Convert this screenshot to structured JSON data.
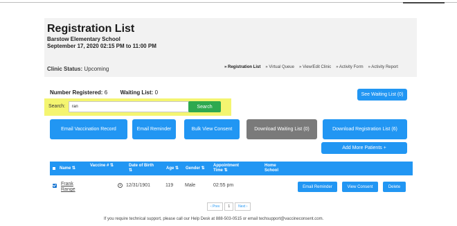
{
  "header": {
    "title": "Registration List",
    "school": "Barstow Elementary School",
    "dates": "September 17, 2020 02:15 PM to 11:00 PM",
    "clinic_status_label": "Clinic Status:",
    "clinic_status_value": "Upcoming"
  },
  "nav": {
    "items": [
      "Registration List",
      "Virtual Queue",
      "View/Edit Clinic",
      "Activity Form",
      "Activity Report"
    ]
  },
  "counts": {
    "registered_label": "Number Registered:",
    "registered_value": "6",
    "waiting_label": "Waiting List:",
    "waiting_value": "0"
  },
  "buttons": {
    "see_waiting": "See Waiting List (0)",
    "email_vaccination": "Email Vaccination Record",
    "email_reminder": "Email Reminder",
    "bulk_view_consent": "Bulk View Consent",
    "download_waiting": "Download Waiting List (0)",
    "download_registration": "Download Registration List (6)",
    "add_patients": "Add More Patients +"
  },
  "search": {
    "label": "Search:",
    "value": "ran",
    "button": "Search"
  },
  "table": {
    "columns": [
      "Name",
      "Vaccine #",
      "Date of Birth",
      "Age",
      "Gender",
      "Appointment Time",
      "Home School"
    ],
    "rows": [
      {
        "name": "Frank Range",
        "dob": "12/31/1901",
        "age": "119",
        "gender": "Male",
        "time": "02:55 pm",
        "actions": [
          "Email Reminder",
          "View Consent",
          "Delete"
        ]
      }
    ]
  },
  "pager": {
    "prev": "‹ Prev",
    "page": "1",
    "next": "Next ›"
  },
  "footer": {
    "text": "If you require technical support, please call our Help Desk at 888-503-0515 or email techsupport@vaccineconsent.com."
  },
  "colors": {
    "primary": "#2196f3",
    "search_button": "#2ea94f",
    "highlight": "#f4f570",
    "disabled_button": "#7a7a7a"
  }
}
